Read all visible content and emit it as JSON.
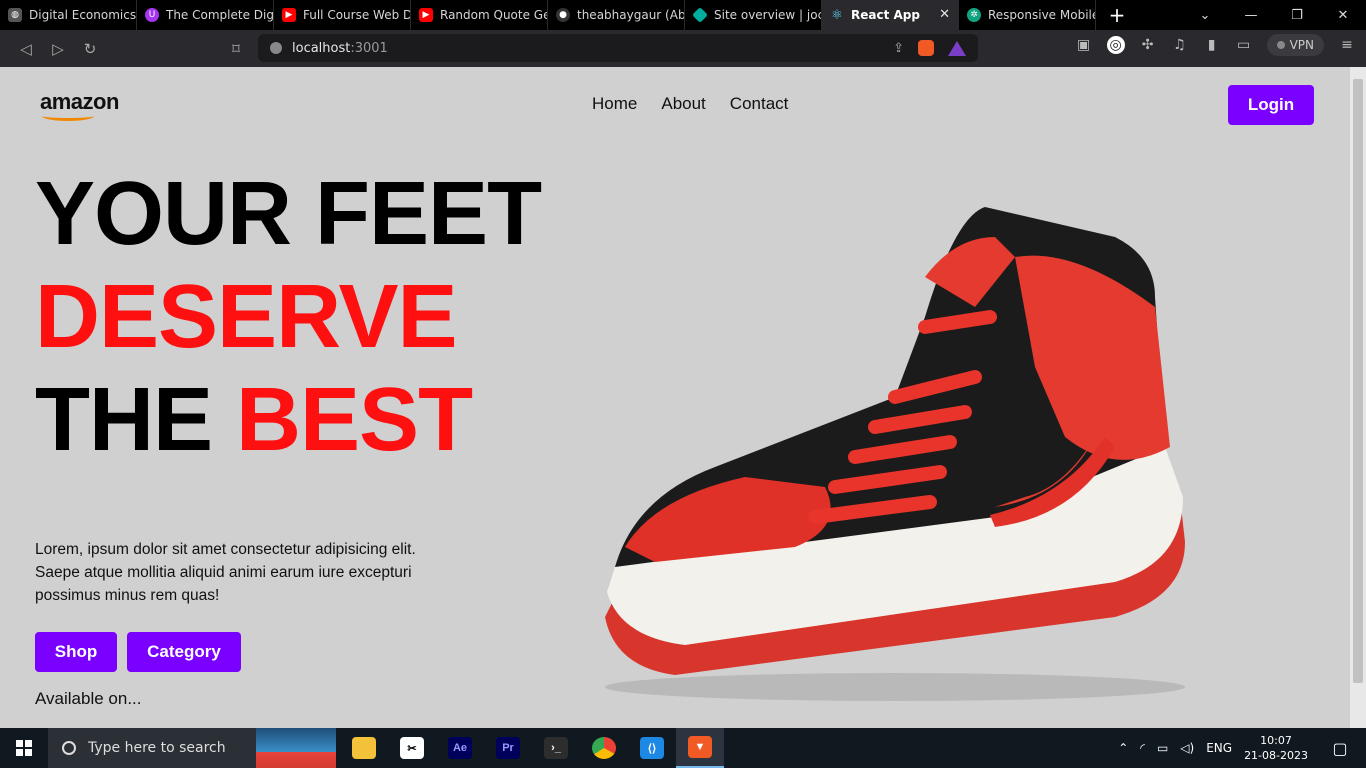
{
  "browser": {
    "tabs": [
      {
        "title": "Digital Economics",
        "icon": "globe-icon",
        "color": "#555555"
      },
      {
        "title": "The Complete Digi",
        "icon": "udemy-icon",
        "color": "#a435f0"
      },
      {
        "title": "Full Course Web D",
        "icon": "youtube-icon",
        "color": "#ff0000"
      },
      {
        "title": "Random Quote Ge",
        "icon": "youtube-icon",
        "color": "#ff0000"
      },
      {
        "title": "theabhaygaur (Abh",
        "icon": "github-icon",
        "color": "#333333"
      },
      {
        "title": "Site overview | jocu",
        "icon": "netlify-icon",
        "color": "#00ad9f"
      },
      {
        "title": "React App",
        "icon": "react-icon",
        "color": "#61dafb",
        "active": true
      },
      {
        "title": "Responsive Mobile",
        "icon": "chatgpt-icon",
        "color": "#10a37f"
      }
    ],
    "close_tab_glyph": "✕",
    "new_tab_glyph": "+",
    "url_host": "localhost",
    "url_port": ":3001",
    "vpn_label": "VPN"
  },
  "page": {
    "logo_text": "amazon",
    "nav": [
      "Home",
      "About",
      "Contact"
    ],
    "login_label": "Login",
    "hero": {
      "line1": "YOUR FEET",
      "line2": "DESERVE",
      "line3_black": "THE",
      "line3_red": "BEST"
    },
    "description": "Lorem, ipsum dolor sit amet consectetur adipisicing elit. Saepe atque mollitia aliquid animi earum iure excepturi possimus minus rem quas!",
    "shop_label": "Shop",
    "category_label": "Category",
    "available_label": "Available on...",
    "accent_color": "#7a00ff",
    "highlight_color": "#ff1010"
  },
  "taskbar": {
    "search_placeholder": "Type here to search",
    "language": "ENG",
    "time": "10:07",
    "date": "21-08-2023"
  }
}
